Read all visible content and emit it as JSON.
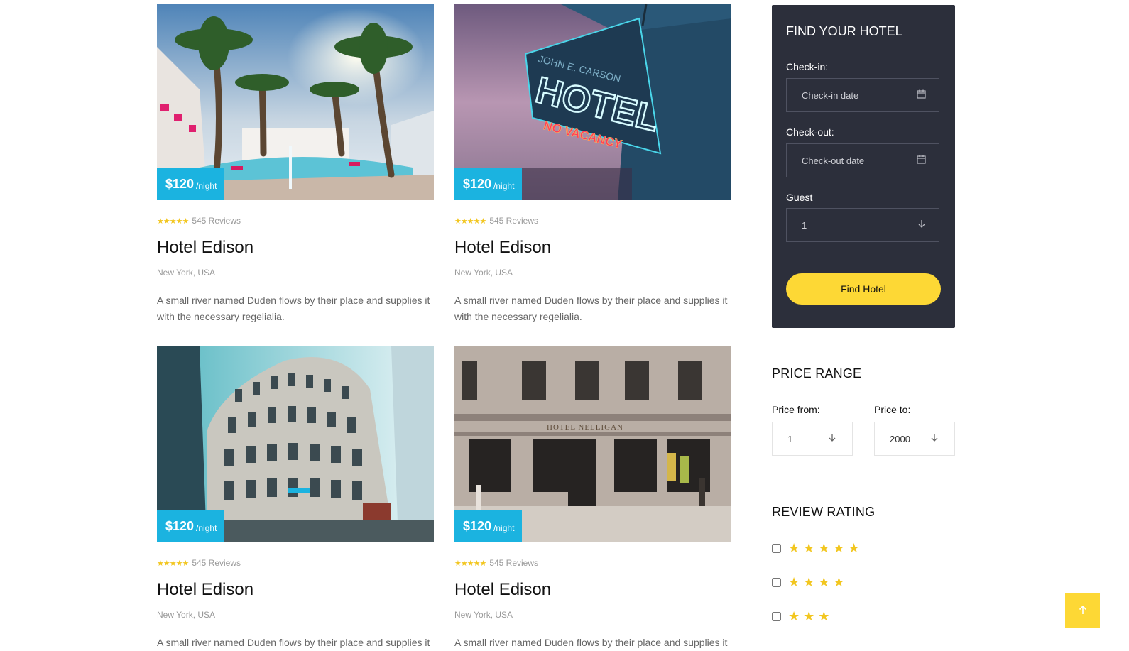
{
  "hotels": [
    {
      "price": "$120",
      "per": "/night",
      "stars": "★★★★★",
      "reviews": "545 Reviews",
      "name": "Hotel Edison",
      "location": "New York, USA",
      "description": "A small river named Duden flows by their place and supplies it with the necessary regelialia."
    },
    {
      "price": "$120",
      "per": "/night",
      "stars": "★★★★★",
      "reviews": "545 Reviews",
      "name": "Hotel Edison",
      "location": "New York, USA",
      "description": "A small river named Duden flows by their place and supplies it with the necessary regelialia."
    },
    {
      "price": "$120",
      "per": "/night",
      "stars": "★★★★★",
      "reviews": "545 Reviews",
      "name": "Hotel Edison",
      "location": "New York, USA",
      "description": "A small river named Duden flows by their place and supplies it"
    },
    {
      "price": "$120",
      "per": "/night",
      "stars": "★★★★★",
      "reviews": "545 Reviews",
      "name": "Hotel Edison",
      "location": "New York, USA",
      "description": "A small river named Duden flows by their place and supplies it"
    }
  ],
  "photo_text": {
    "neon_hotel": "HOTEL",
    "neon_vacancy": "NO VACANCY",
    "neon_owner": "JOHN E. CARSON",
    "facade_sign": "HOTEL NELLIGAN"
  },
  "find_hotel": {
    "title": "FIND YOUR HOTEL",
    "checkin_label": "Check-in:",
    "checkin_placeholder": "Check-in date",
    "checkout_label": "Check-out:",
    "checkout_placeholder": "Check-out date",
    "guest_label": "Guest",
    "guest_value": "1",
    "button": "Find Hotel",
    "calendar_icon": "calendar-icon",
    "dropdown_icon": "arrow-down-icon"
  },
  "price_range": {
    "title": "PRICE RANGE",
    "from_label": "Price from:",
    "from_value": "1",
    "to_label": "Price to:",
    "to_value": "2000"
  },
  "review_rating": {
    "title": "REVIEW RATING",
    "options": [
      {
        "stars": "★★★★★",
        "rating": 5
      },
      {
        "stars": "★★★★",
        "rating": 4
      },
      {
        "stars": "★★★",
        "rating": 3
      }
    ]
  },
  "back_to_top_icon": "arrow-up-icon",
  "colors": {
    "accent_blue": "#1bb3e0",
    "accent_yellow": "#fdd835",
    "panel_dark": "#2c2f3b",
    "star_gold": "#f2c61f"
  }
}
